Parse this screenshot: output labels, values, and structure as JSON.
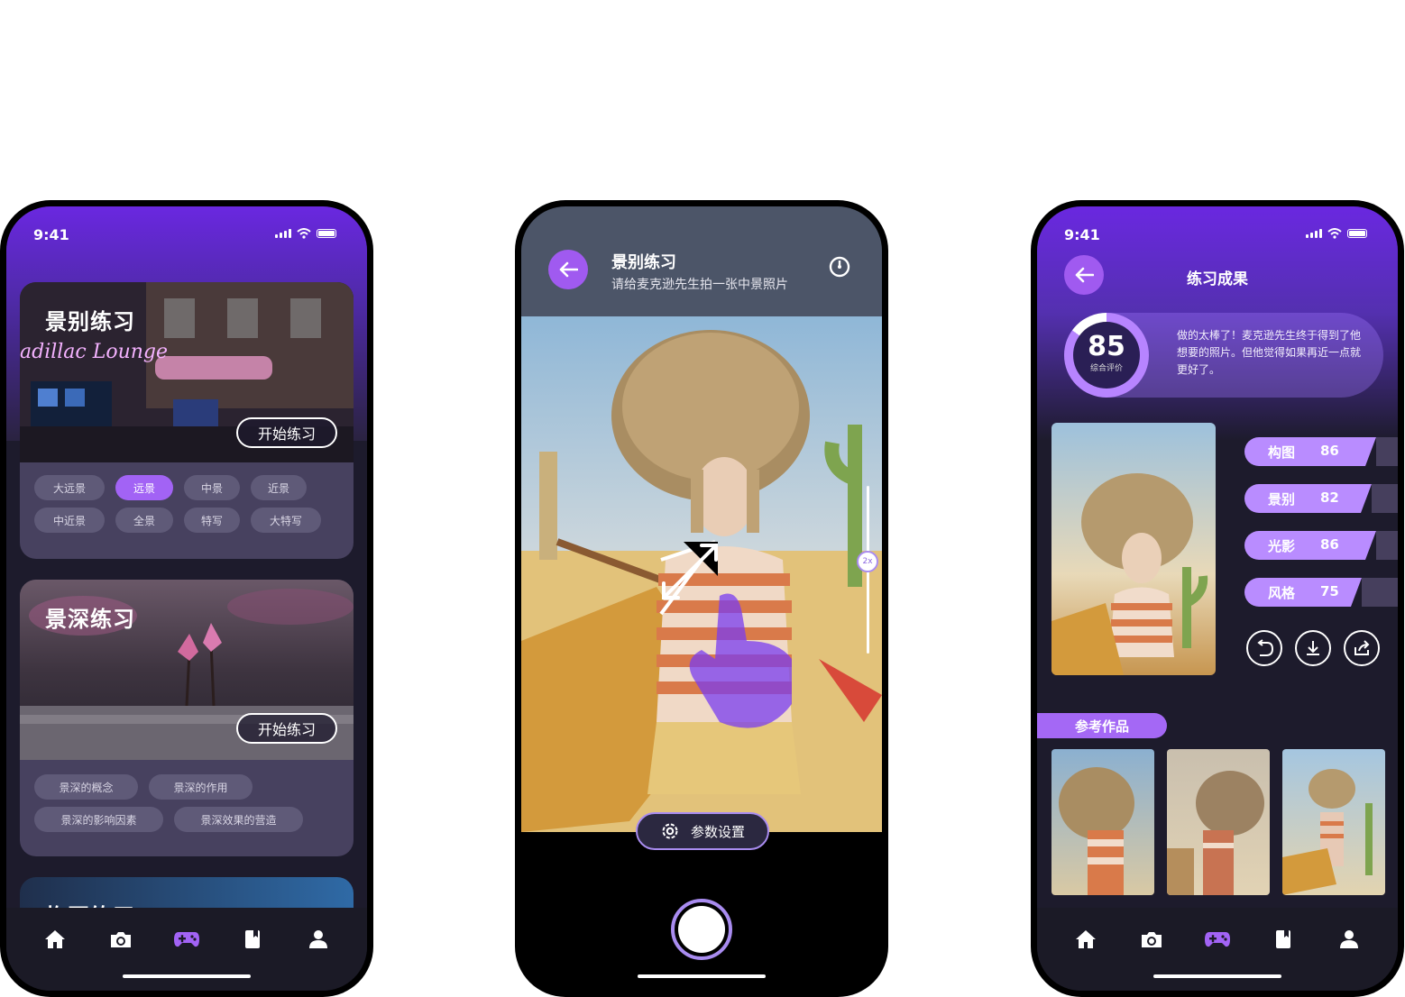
{
  "status": {
    "time": "9:41"
  },
  "practice": {
    "cards": [
      {
        "title": "景别练习",
        "button": "开始练习",
        "chips": [
          "大远景",
          "远景",
          "中景",
          "近景",
          "中近景",
          "全景",
          "特写",
          "大特写"
        ],
        "selected": 1
      },
      {
        "title": "景深练习",
        "button": "开始练习",
        "chips": [
          "景深的概念",
          "景深的作用",
          "景深的影响因素",
          "景深效果的营造"
        ]
      },
      {
        "title": "构图练习"
      }
    ]
  },
  "tabbar": {
    "items": [
      "home-icon",
      "camera-icon",
      "gamepad-icon",
      "book-icon",
      "profile-icon"
    ],
    "active": 2
  },
  "camera": {
    "title": "景别练习",
    "subtitle": "请给麦克逊先生拍一张中景照片",
    "zoom": "2x",
    "params_button": "参数设置"
  },
  "result": {
    "title": "练习成果",
    "score": "85",
    "score_label": "综合评价",
    "comment": "做的太棒了！麦克逊先生终于得到了他想要的照片。但他觉得如果再近一点就更好了。",
    "metrics": [
      {
        "label": "构图",
        "value": "86"
      },
      {
        "label": "景别",
        "value": "82"
      },
      {
        "label": "光影",
        "value": "86"
      },
      {
        "label": "风格",
        "value": "75"
      }
    ],
    "reference_label": "参考作品"
  },
  "colors": {
    "accent": "#a263f5",
    "purple_top": "#6a28e0",
    "dark_bg": "#1d1b2c"
  }
}
